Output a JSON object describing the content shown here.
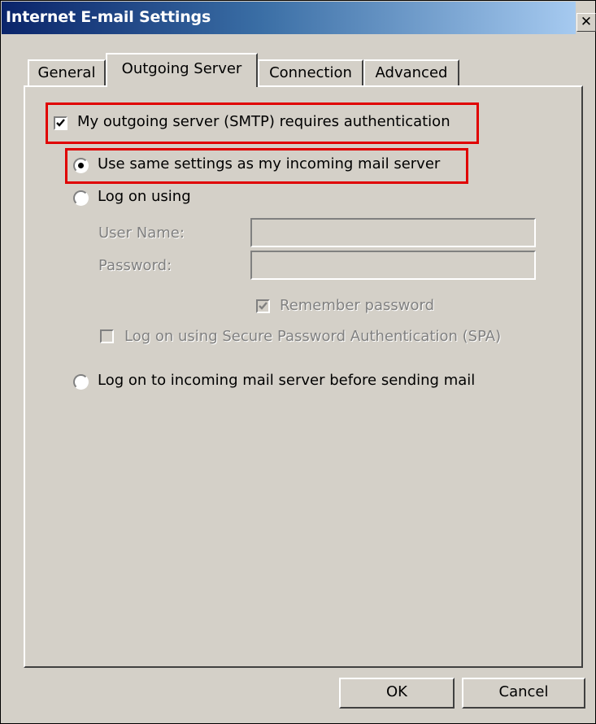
{
  "window": {
    "title": "Internet E-mail Settings",
    "close_glyph": "✕"
  },
  "tabs": [
    {
      "label": "General"
    },
    {
      "label": "Outgoing Server"
    },
    {
      "label": "Connection"
    },
    {
      "label": "Advanced"
    }
  ],
  "auth": {
    "requires_auth_label": "My outgoing server (SMTP) requires authentication",
    "requires_auth_checked": true,
    "options": {
      "same_settings": "Use same settings as my incoming mail server",
      "log_on_using": "Log on using",
      "before_sending": "Log on to incoming mail server before sending mail"
    },
    "selected_option": "same_settings",
    "username_label": "User Name:",
    "username_value": "",
    "password_label": "Password:",
    "password_value": "",
    "remember_password_label": "Remember password",
    "remember_password_checked": true,
    "spa_label": "Log on using Secure Password Authentication (SPA)",
    "spa_checked": false
  },
  "buttons": {
    "ok": "OK",
    "cancel": "Cancel"
  },
  "accent": {
    "highlight": "#e00000",
    "titlebar_start": "#0a246a",
    "titlebar_end": "#a6caf0"
  }
}
